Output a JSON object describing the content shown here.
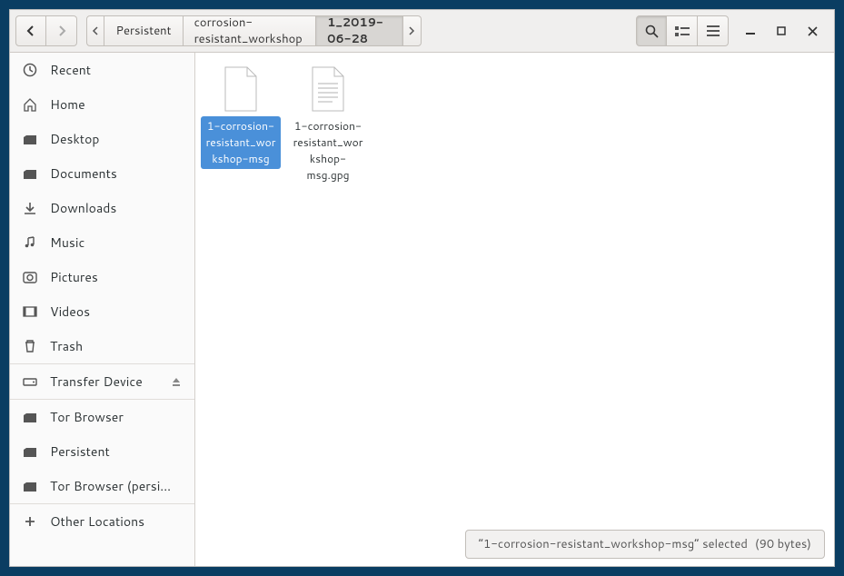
{
  "pathbar": {
    "segments": [
      {
        "label": "Persistent",
        "current": false
      },
      {
        "label": "corrosion-resistant_workshop",
        "current": false
      },
      {
        "label": "1_2019-06-28",
        "current": true
      }
    ]
  },
  "sidebar": {
    "main": [
      {
        "icon": "recent",
        "label": "Recent"
      },
      {
        "icon": "home",
        "label": "Home"
      },
      {
        "icon": "desktop",
        "label": "Desktop"
      },
      {
        "icon": "folder",
        "label": "Documents"
      },
      {
        "icon": "downloads",
        "label": "Downloads"
      },
      {
        "icon": "music",
        "label": "Music"
      },
      {
        "icon": "pictures",
        "label": "Pictures"
      },
      {
        "icon": "videos",
        "label": "Videos"
      },
      {
        "icon": "trash",
        "label": "Trash"
      }
    ],
    "devices": [
      {
        "icon": "drive",
        "label": "Transfer Device",
        "eject": true
      }
    ],
    "bookmarks": [
      {
        "icon": "folder",
        "label": "Tor Browser"
      },
      {
        "icon": "folder",
        "label": "Persistent"
      },
      {
        "icon": "folder",
        "label": "Tor Browser (persi..."
      }
    ],
    "other": [
      {
        "icon": "plus",
        "label": "Other Locations"
      }
    ]
  },
  "files": [
    {
      "name": "1-corrosion-resistant_workshop-msg",
      "type": "blank",
      "selected": true
    },
    {
      "name": "1-corrosion-resistant_workshop-msg.gpg",
      "type": "text",
      "selected": false
    }
  ],
  "status": {
    "text": "“1-corrosion-resistant_workshop-msg” selected",
    "detail": "(90 bytes)"
  }
}
